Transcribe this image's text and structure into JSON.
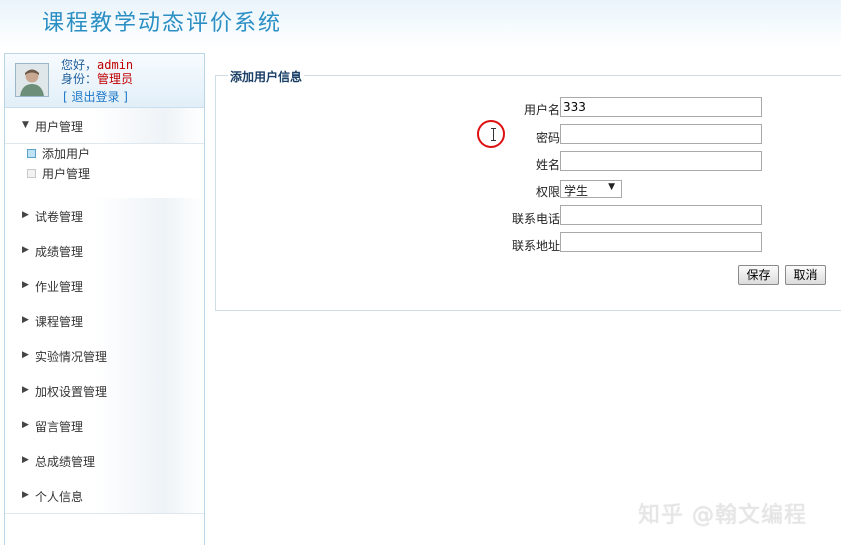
{
  "header": {
    "title": "课程教学动态评价系统"
  },
  "user": {
    "greeting_label": "您好，",
    "username": "admin",
    "role_label": "身份：",
    "role_value": "管理员",
    "logout_text": "[ 退出登录 ]"
  },
  "sidebar": {
    "groups": [
      {
        "label": "用户管理",
        "expanded": true,
        "items": [
          {
            "label": "添加用户",
            "active": true
          },
          {
            "label": "用户管理",
            "active": false
          }
        ]
      },
      {
        "label": "试卷管理"
      },
      {
        "label": "成绩管理"
      },
      {
        "label": "作业管理"
      },
      {
        "label": "课程管理"
      },
      {
        "label": "实验情况管理"
      },
      {
        "label": "加权设置管理"
      },
      {
        "label": "留言管理"
      },
      {
        "label": "总成绩管理"
      },
      {
        "label": "个人信息"
      }
    ],
    "arrow_expanded": "▼",
    "arrow_collapsed": "▶"
  },
  "form": {
    "legend": "添加用户信息",
    "fields": {
      "username": {
        "label": "用户名",
        "value": "333"
      },
      "password": {
        "label": "密码",
        "value": ""
      },
      "name": {
        "label": "姓名",
        "value": ""
      },
      "role": {
        "label": "权限",
        "value": "学生"
      },
      "phone": {
        "label": "联系电话",
        "value": ""
      },
      "address": {
        "label": "联系地址",
        "value": ""
      }
    },
    "save_label": "保存",
    "cancel_label": "取消"
  },
  "watermark": "知乎 @翰文编程",
  "colors": {
    "title": "#2b8fc4",
    "accent": "#c00000",
    "link": "#1f78c8"
  }
}
